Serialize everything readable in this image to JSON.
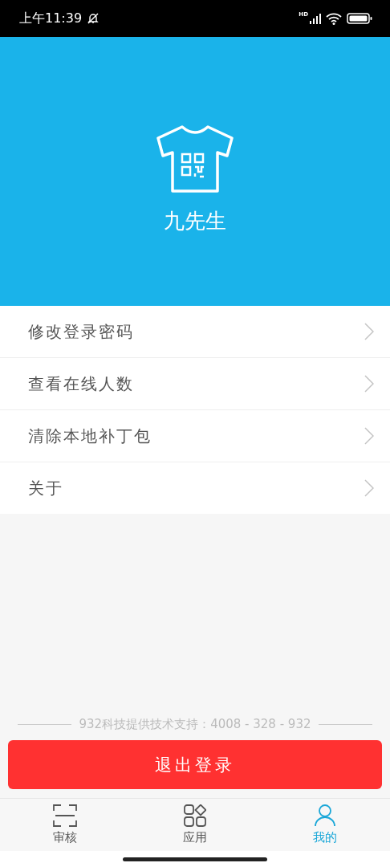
{
  "status_bar": {
    "time": "上午11:39",
    "network": "HD"
  },
  "profile": {
    "name": "九先生"
  },
  "menu": [
    {
      "label": "修改登录密码"
    },
    {
      "label": "查看在线人数"
    },
    {
      "label": "清除本地补丁包"
    },
    {
      "label": "关于"
    }
  ],
  "footer": {
    "support": "932科技提供技术支持：4008 - 328 - 932"
  },
  "logout_button": "退出登录",
  "tabs": [
    {
      "label": "审核",
      "kind": "scan",
      "selected": false
    },
    {
      "label": "应用",
      "kind": "apps",
      "selected": false
    },
    {
      "label": "我的",
      "kind": "person",
      "selected": true
    }
  ]
}
